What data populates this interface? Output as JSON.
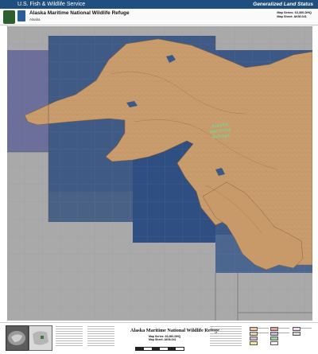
{
  "header": {
    "agency": "U.S. Fish & Wildlife Service",
    "layer_title": "Generalized Land Status",
    "refuge_name": "Alaska Maritime National Wildlife Refuge",
    "state": "Alaska",
    "map_series": "Map Series: 63,360-DHQ",
    "map_sheet": "Map Sheet: AKM-041"
  },
  "map": {
    "region_label_lines": [
      "Alaska",
      "Maritime",
      "Refuge"
    ],
    "colors": {
      "background": "#a9a9a9",
      "water": "#3a5680",
      "land": "#c99c6e",
      "region_label": "#7fcf8f"
    }
  },
  "footer": {
    "title": "Alaska Maritime National Wildlife Refuge",
    "map_series": "Map Series: 63,360-DHQ",
    "map_sheet": "Map Sheet: AKM-041",
    "icons": [
      "overview-map-icon",
      "locator-map-icon",
      "scale-bar-icon",
      "legend-icon"
    ]
  }
}
